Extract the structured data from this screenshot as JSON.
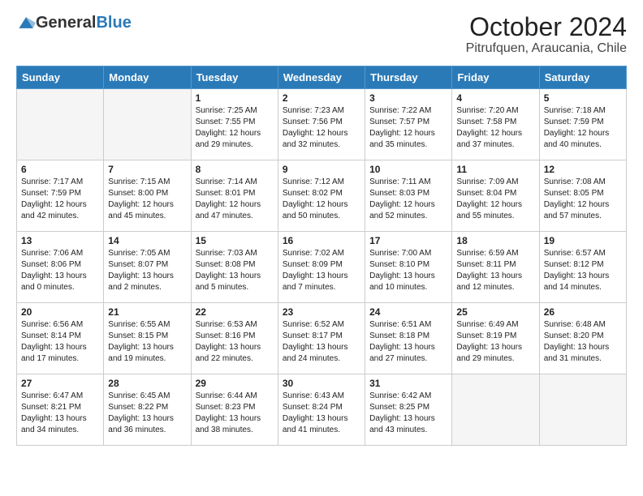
{
  "header": {
    "logo_general": "General",
    "logo_blue": "Blue",
    "month": "October 2024",
    "location": "Pitrufquen, Araucania, Chile"
  },
  "weekdays": [
    "Sunday",
    "Monday",
    "Tuesday",
    "Wednesday",
    "Thursday",
    "Friday",
    "Saturday"
  ],
  "weeks": [
    [
      {
        "day": null
      },
      {
        "day": null
      },
      {
        "day": "1",
        "sunrise": "Sunrise: 7:25 AM",
        "sunset": "Sunset: 7:55 PM",
        "daylight": "Daylight: 12 hours and 29 minutes."
      },
      {
        "day": "2",
        "sunrise": "Sunrise: 7:23 AM",
        "sunset": "Sunset: 7:56 PM",
        "daylight": "Daylight: 12 hours and 32 minutes."
      },
      {
        "day": "3",
        "sunrise": "Sunrise: 7:22 AM",
        "sunset": "Sunset: 7:57 PM",
        "daylight": "Daylight: 12 hours and 35 minutes."
      },
      {
        "day": "4",
        "sunrise": "Sunrise: 7:20 AM",
        "sunset": "Sunset: 7:58 PM",
        "daylight": "Daylight: 12 hours and 37 minutes."
      },
      {
        "day": "5",
        "sunrise": "Sunrise: 7:18 AM",
        "sunset": "Sunset: 7:59 PM",
        "daylight": "Daylight: 12 hours and 40 minutes."
      }
    ],
    [
      {
        "day": "6",
        "sunrise": "Sunrise: 7:17 AM",
        "sunset": "Sunset: 7:59 PM",
        "daylight": "Daylight: 12 hours and 42 minutes."
      },
      {
        "day": "7",
        "sunrise": "Sunrise: 7:15 AM",
        "sunset": "Sunset: 8:00 PM",
        "daylight": "Daylight: 12 hours and 45 minutes."
      },
      {
        "day": "8",
        "sunrise": "Sunrise: 7:14 AM",
        "sunset": "Sunset: 8:01 PM",
        "daylight": "Daylight: 12 hours and 47 minutes."
      },
      {
        "day": "9",
        "sunrise": "Sunrise: 7:12 AM",
        "sunset": "Sunset: 8:02 PM",
        "daylight": "Daylight: 12 hours and 50 minutes."
      },
      {
        "day": "10",
        "sunrise": "Sunrise: 7:11 AM",
        "sunset": "Sunset: 8:03 PM",
        "daylight": "Daylight: 12 hours and 52 minutes."
      },
      {
        "day": "11",
        "sunrise": "Sunrise: 7:09 AM",
        "sunset": "Sunset: 8:04 PM",
        "daylight": "Daylight: 12 hours and 55 minutes."
      },
      {
        "day": "12",
        "sunrise": "Sunrise: 7:08 AM",
        "sunset": "Sunset: 8:05 PM",
        "daylight": "Daylight: 12 hours and 57 minutes."
      }
    ],
    [
      {
        "day": "13",
        "sunrise": "Sunrise: 7:06 AM",
        "sunset": "Sunset: 8:06 PM",
        "daylight": "Daylight: 13 hours and 0 minutes."
      },
      {
        "day": "14",
        "sunrise": "Sunrise: 7:05 AM",
        "sunset": "Sunset: 8:07 PM",
        "daylight": "Daylight: 13 hours and 2 minutes."
      },
      {
        "day": "15",
        "sunrise": "Sunrise: 7:03 AM",
        "sunset": "Sunset: 8:08 PM",
        "daylight": "Daylight: 13 hours and 5 minutes."
      },
      {
        "day": "16",
        "sunrise": "Sunrise: 7:02 AM",
        "sunset": "Sunset: 8:09 PM",
        "daylight": "Daylight: 13 hours and 7 minutes."
      },
      {
        "day": "17",
        "sunrise": "Sunrise: 7:00 AM",
        "sunset": "Sunset: 8:10 PM",
        "daylight": "Daylight: 13 hours and 10 minutes."
      },
      {
        "day": "18",
        "sunrise": "Sunrise: 6:59 AM",
        "sunset": "Sunset: 8:11 PM",
        "daylight": "Daylight: 13 hours and 12 minutes."
      },
      {
        "day": "19",
        "sunrise": "Sunrise: 6:57 AM",
        "sunset": "Sunset: 8:12 PM",
        "daylight": "Daylight: 13 hours and 14 minutes."
      }
    ],
    [
      {
        "day": "20",
        "sunrise": "Sunrise: 6:56 AM",
        "sunset": "Sunset: 8:14 PM",
        "daylight": "Daylight: 13 hours and 17 minutes."
      },
      {
        "day": "21",
        "sunrise": "Sunrise: 6:55 AM",
        "sunset": "Sunset: 8:15 PM",
        "daylight": "Daylight: 13 hours and 19 minutes."
      },
      {
        "day": "22",
        "sunrise": "Sunrise: 6:53 AM",
        "sunset": "Sunset: 8:16 PM",
        "daylight": "Daylight: 13 hours and 22 minutes."
      },
      {
        "day": "23",
        "sunrise": "Sunrise: 6:52 AM",
        "sunset": "Sunset: 8:17 PM",
        "daylight": "Daylight: 13 hours and 24 minutes."
      },
      {
        "day": "24",
        "sunrise": "Sunrise: 6:51 AM",
        "sunset": "Sunset: 8:18 PM",
        "daylight": "Daylight: 13 hours and 27 minutes."
      },
      {
        "day": "25",
        "sunrise": "Sunrise: 6:49 AM",
        "sunset": "Sunset: 8:19 PM",
        "daylight": "Daylight: 13 hours and 29 minutes."
      },
      {
        "day": "26",
        "sunrise": "Sunrise: 6:48 AM",
        "sunset": "Sunset: 8:20 PM",
        "daylight": "Daylight: 13 hours and 31 minutes."
      }
    ],
    [
      {
        "day": "27",
        "sunrise": "Sunrise: 6:47 AM",
        "sunset": "Sunset: 8:21 PM",
        "daylight": "Daylight: 13 hours and 34 minutes."
      },
      {
        "day": "28",
        "sunrise": "Sunrise: 6:45 AM",
        "sunset": "Sunset: 8:22 PM",
        "daylight": "Daylight: 13 hours and 36 minutes."
      },
      {
        "day": "29",
        "sunrise": "Sunrise: 6:44 AM",
        "sunset": "Sunset: 8:23 PM",
        "daylight": "Daylight: 13 hours and 38 minutes."
      },
      {
        "day": "30",
        "sunrise": "Sunrise: 6:43 AM",
        "sunset": "Sunset: 8:24 PM",
        "daylight": "Daylight: 13 hours and 41 minutes."
      },
      {
        "day": "31",
        "sunrise": "Sunrise: 6:42 AM",
        "sunset": "Sunset: 8:25 PM",
        "daylight": "Daylight: 13 hours and 43 minutes."
      },
      {
        "day": null
      },
      {
        "day": null
      }
    ]
  ]
}
